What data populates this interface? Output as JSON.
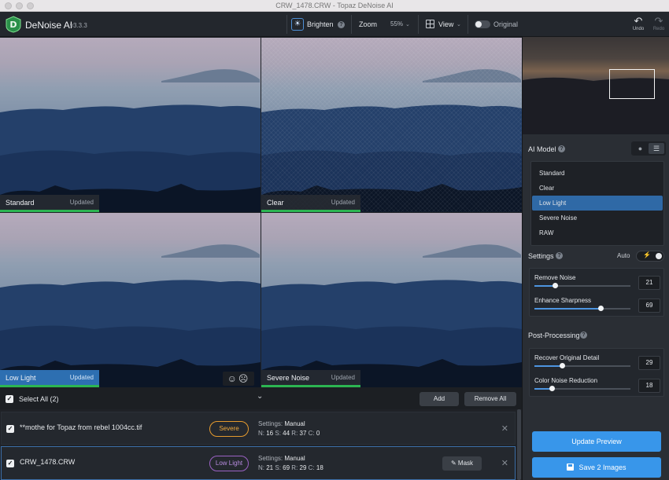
{
  "window": {
    "title": "CRW_1478.CRW - Topaz DeNoise AI"
  },
  "app": {
    "name": "DeNoise AI",
    "version": "v3.3.3"
  },
  "toolbar": {
    "brighten_label": "Brighten",
    "zoom_label": "Zoom",
    "zoom_value": "55%",
    "view_label": "View",
    "original_label": "Original",
    "undo_label": "Undo",
    "redo_label": "Redo"
  },
  "previews": [
    {
      "name": "Standard",
      "status": "Updated",
      "active": false
    },
    {
      "name": "Clear",
      "status": "Updated",
      "active": false
    },
    {
      "name": "Low Light",
      "status": "Updated",
      "active": true
    },
    {
      "name": "Severe Noise",
      "status": "Updated",
      "active": false
    }
  ],
  "listbar": {
    "select_all": "Select All (2)",
    "add_label": "Add",
    "remove_all_label": "Remove All"
  },
  "images": [
    {
      "filename": "**mothe for Topaz from rebel 1004cc.tif",
      "model": "Severe",
      "settings_label": "Settings:",
      "settings_mode": "Manual",
      "n": "16",
      "s": "44",
      "r": "37",
      "c": "0"
    },
    {
      "filename": "CRW_1478.CRW",
      "model": "Low Light",
      "settings_label": "Settings:",
      "settings_mode": "Manual",
      "n": "21",
      "s": "69",
      "r": "29",
      "c": "18",
      "mask_label": "Mask"
    }
  ],
  "panel": {
    "ai_model_label": "AI Model",
    "models": [
      "Standard",
      "Clear",
      "Low Light",
      "Severe Noise",
      "RAW"
    ],
    "selected_model": "Low Light",
    "settings_label": "Settings",
    "auto_label": "Auto",
    "remove_noise": {
      "label": "Remove Noise",
      "value": "21",
      "pct": 21
    },
    "enhance_sharpness": {
      "label": "Enhance Sharpness",
      "value": "69",
      "pct": 69
    },
    "post_processing_label": "Post-Processing",
    "recover_detail": {
      "label": "Recover Original Detail",
      "value": "29",
      "pct": 29
    },
    "color_noise": {
      "label": "Color Noise Reduction",
      "value": "18",
      "pct": 18
    },
    "update_preview_label": "Update Preview",
    "save_label": "Save 2 Images"
  },
  "colors": {
    "accent": "#3896ea",
    "updated_bar": "#2cb552",
    "severe": "#f0a93c",
    "low_light": "#b88ce0"
  }
}
